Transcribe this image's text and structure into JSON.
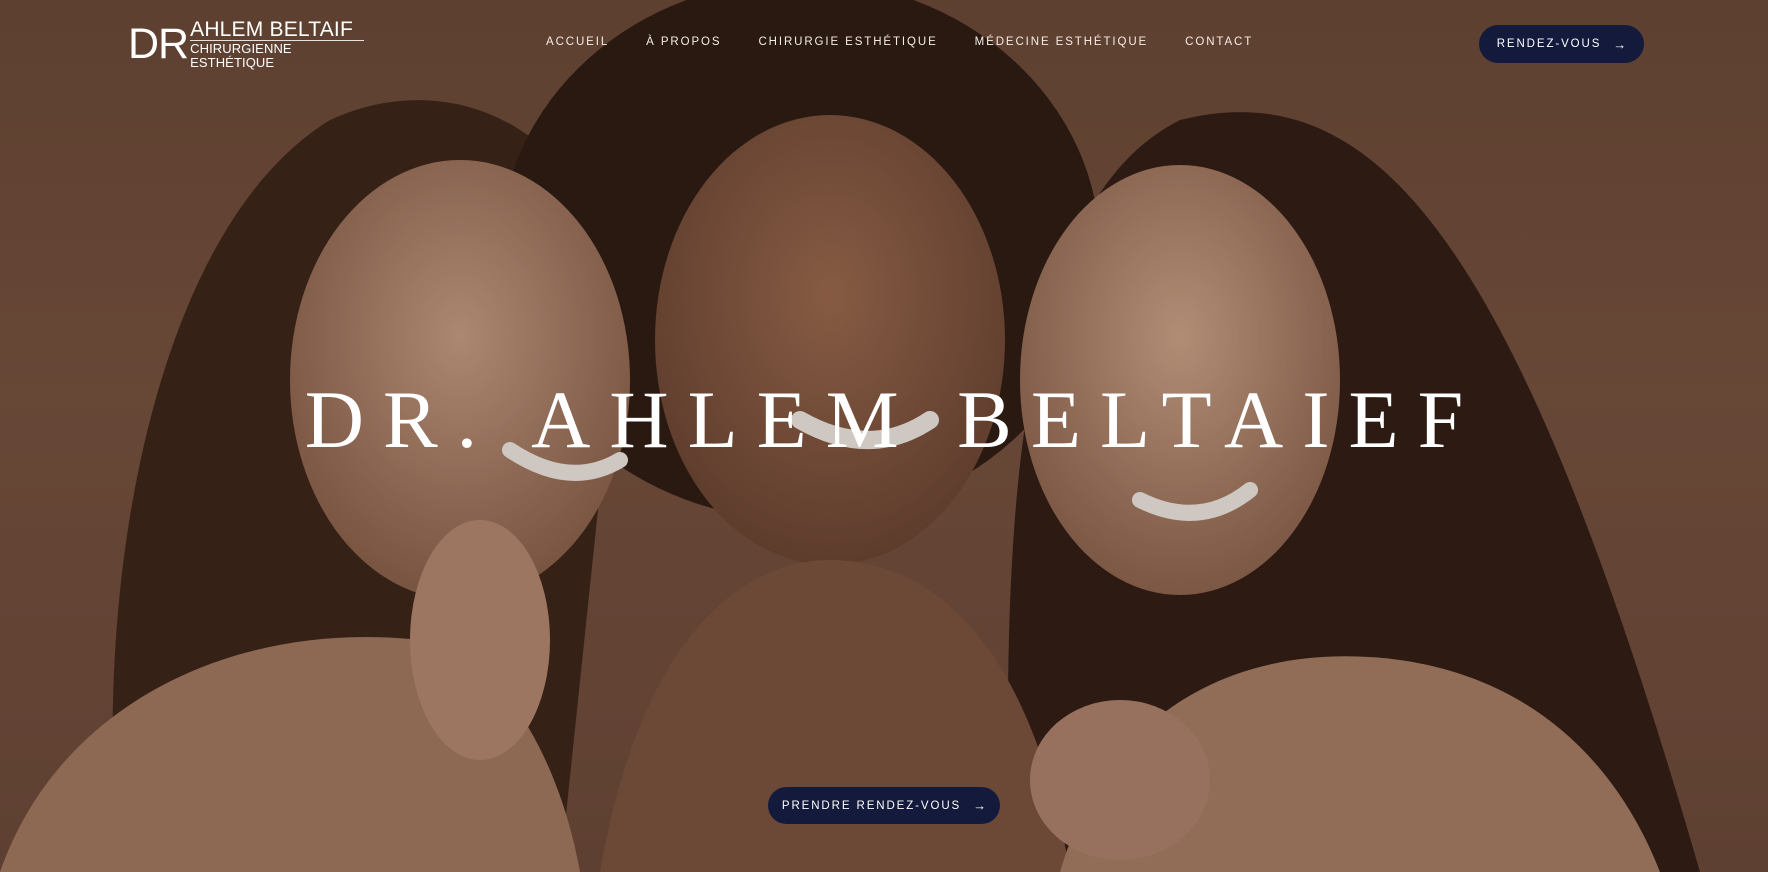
{
  "logo": {
    "mark": "DR",
    "name": "AHLEM BELTAIF",
    "subtitle": "CHIRURGIENNE ESTHÉTIQUE"
  },
  "nav": {
    "items": [
      {
        "label": "ACCUEIL"
      },
      {
        "label": "À PROPOS"
      },
      {
        "label": "CHIRURGIE ESTHÉTIQUE"
      },
      {
        "label": "MÉDECINE ESTHÉTIQUE"
      },
      {
        "label": "CONTACT"
      }
    ]
  },
  "header_button": {
    "label": "RENDEZ-VOUS",
    "arrow": "→"
  },
  "hero": {
    "title": "DR. AHLEM BELTAIEF"
  },
  "cta_button": {
    "label": "PRENDRE RENDEZ-VOUS",
    "arrow": "→"
  },
  "colors": {
    "background": "#76523f",
    "button": "#141a3c",
    "text": "#ffffff"
  }
}
